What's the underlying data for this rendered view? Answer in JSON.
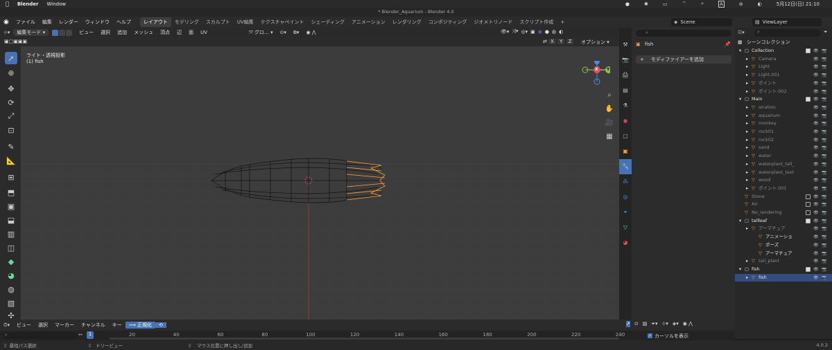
{
  "macos": {
    "apple": "",
    "app_name": "Blender",
    "menu": "Window",
    "datetime": "5月12日(日)  21:10",
    "input_badge": "A"
  },
  "window": {
    "title": "* Blender_Aquarium - Blender 4.0"
  },
  "topbar": {
    "menus": [
      "ファイル",
      "編集",
      "レンダー",
      "ウィンドウ",
      "ヘルプ"
    ],
    "workspaces": [
      "レイアウト",
      "モデリング",
      "スカルプト",
      "UV編集",
      "テクスチャペイント",
      "シェーディング",
      "アニメーション",
      "レンダリング",
      "コンポジティング",
      "ジオメトリノード",
      "スクリプト作成"
    ],
    "add_tab": "+",
    "scene": "Scene",
    "view_layer": "ViewLayer"
  },
  "viewport_header": {
    "mode": "編集モード",
    "menus": [
      "ビュー",
      "選択",
      "追加",
      "メッシュ",
      "頂点",
      "辺",
      "面",
      "UV"
    ],
    "transform": "グロ…",
    "options": "オプション",
    "axes": [
      "X",
      "Y",
      "Z"
    ]
  },
  "viewport": {
    "view_name": "ライト・透視投影",
    "object_name": "(1) fish"
  },
  "gizmo": {
    "x": "X",
    "y": "Y",
    "z": "Z"
  },
  "properties": {
    "object": "fish",
    "add_modifier": "モディファイアーを追加"
  },
  "outliner": {
    "title": "シーンコレクション",
    "rows": [
      {
        "label": "Collection",
        "indent": 1,
        "type": "collection",
        "check": true
      },
      {
        "label": "Camera",
        "indent": 2,
        "type": "faded"
      },
      {
        "label": "Light",
        "indent": 2,
        "type": "faded"
      },
      {
        "label": "Light.001",
        "indent": 2,
        "type": "faded"
      },
      {
        "label": "ポイント",
        "indent": 2,
        "type": "faded"
      },
      {
        "label": "ポイント.002",
        "indent": 2,
        "type": "faded"
      },
      {
        "label": "Main",
        "indent": 1,
        "type": "collection",
        "check": true
      },
      {
        "label": "airation",
        "indent": 2,
        "type": "faded"
      },
      {
        "label": "aquarium",
        "indent": 2,
        "type": "faded"
      },
      {
        "label": "monkey",
        "indent": 2,
        "type": "faded"
      },
      {
        "label": "rock01",
        "indent": 2,
        "type": "faded"
      },
      {
        "label": "rock02",
        "indent": 2,
        "type": "faded"
      },
      {
        "label": "sand",
        "indent": 2,
        "type": "faded"
      },
      {
        "label": "water",
        "indent": 2,
        "type": "faded"
      },
      {
        "label": "waterplant_tall_",
        "indent": 2,
        "type": "faded"
      },
      {
        "label": "waterplant_text",
        "indent": 2,
        "type": "faded"
      },
      {
        "label": "wood",
        "indent": 2,
        "type": "faded"
      },
      {
        "label": "ポイント.001",
        "indent": 2,
        "type": "faded"
      },
      {
        "label": "Stone",
        "indent": 1,
        "type": "faded",
        "check": false
      },
      {
        "label": "Air",
        "indent": 1,
        "type": "faded",
        "check": false
      },
      {
        "label": "No_rendering",
        "indent": 1,
        "type": "faded",
        "check": false
      },
      {
        "label": "tallleaf",
        "indent": 1,
        "type": "collection",
        "check": true
      },
      {
        "label": "アーマチュア",
        "indent": 2,
        "type": "faded"
      },
      {
        "label": "アニメーショ",
        "indent": 3,
        "type": "normal"
      },
      {
        "label": "ポーズ",
        "indent": 3,
        "type": "normal"
      },
      {
        "label": "アーマチュア",
        "indent": 3,
        "type": "normal"
      },
      {
        "label": "tall_plant",
        "indent": 2,
        "type": "faded"
      },
      {
        "label": "fish",
        "indent": 1,
        "type": "collection",
        "check": true
      },
      {
        "label": "fish",
        "indent": 2,
        "type": "selected"
      }
    ]
  },
  "timeline": {
    "menus": [
      "ビュー",
      "選択",
      "マーカー",
      "チャンネル",
      "キー"
    ],
    "normalize": "正規化",
    "current_frame": "1",
    "ticks": [
      "20",
      "40",
      "60",
      "80",
      "100",
      "120",
      "140",
      "160",
      "180",
      "200",
      "220",
      "240"
    ],
    "show_cursor": "カーソルを表示"
  },
  "status": {
    "left": "最短パス選択",
    "mid1": "ドリービュー",
    "mid2": "マウス位置に押し出し/追加",
    "version": "4.0.2"
  },
  "colors": {
    "accent": "#4772b3",
    "orange": "#ffa133",
    "x_axis": "#e84a5f",
    "y_axis": "#8bc34a",
    "z_axis": "#4a89e8"
  }
}
